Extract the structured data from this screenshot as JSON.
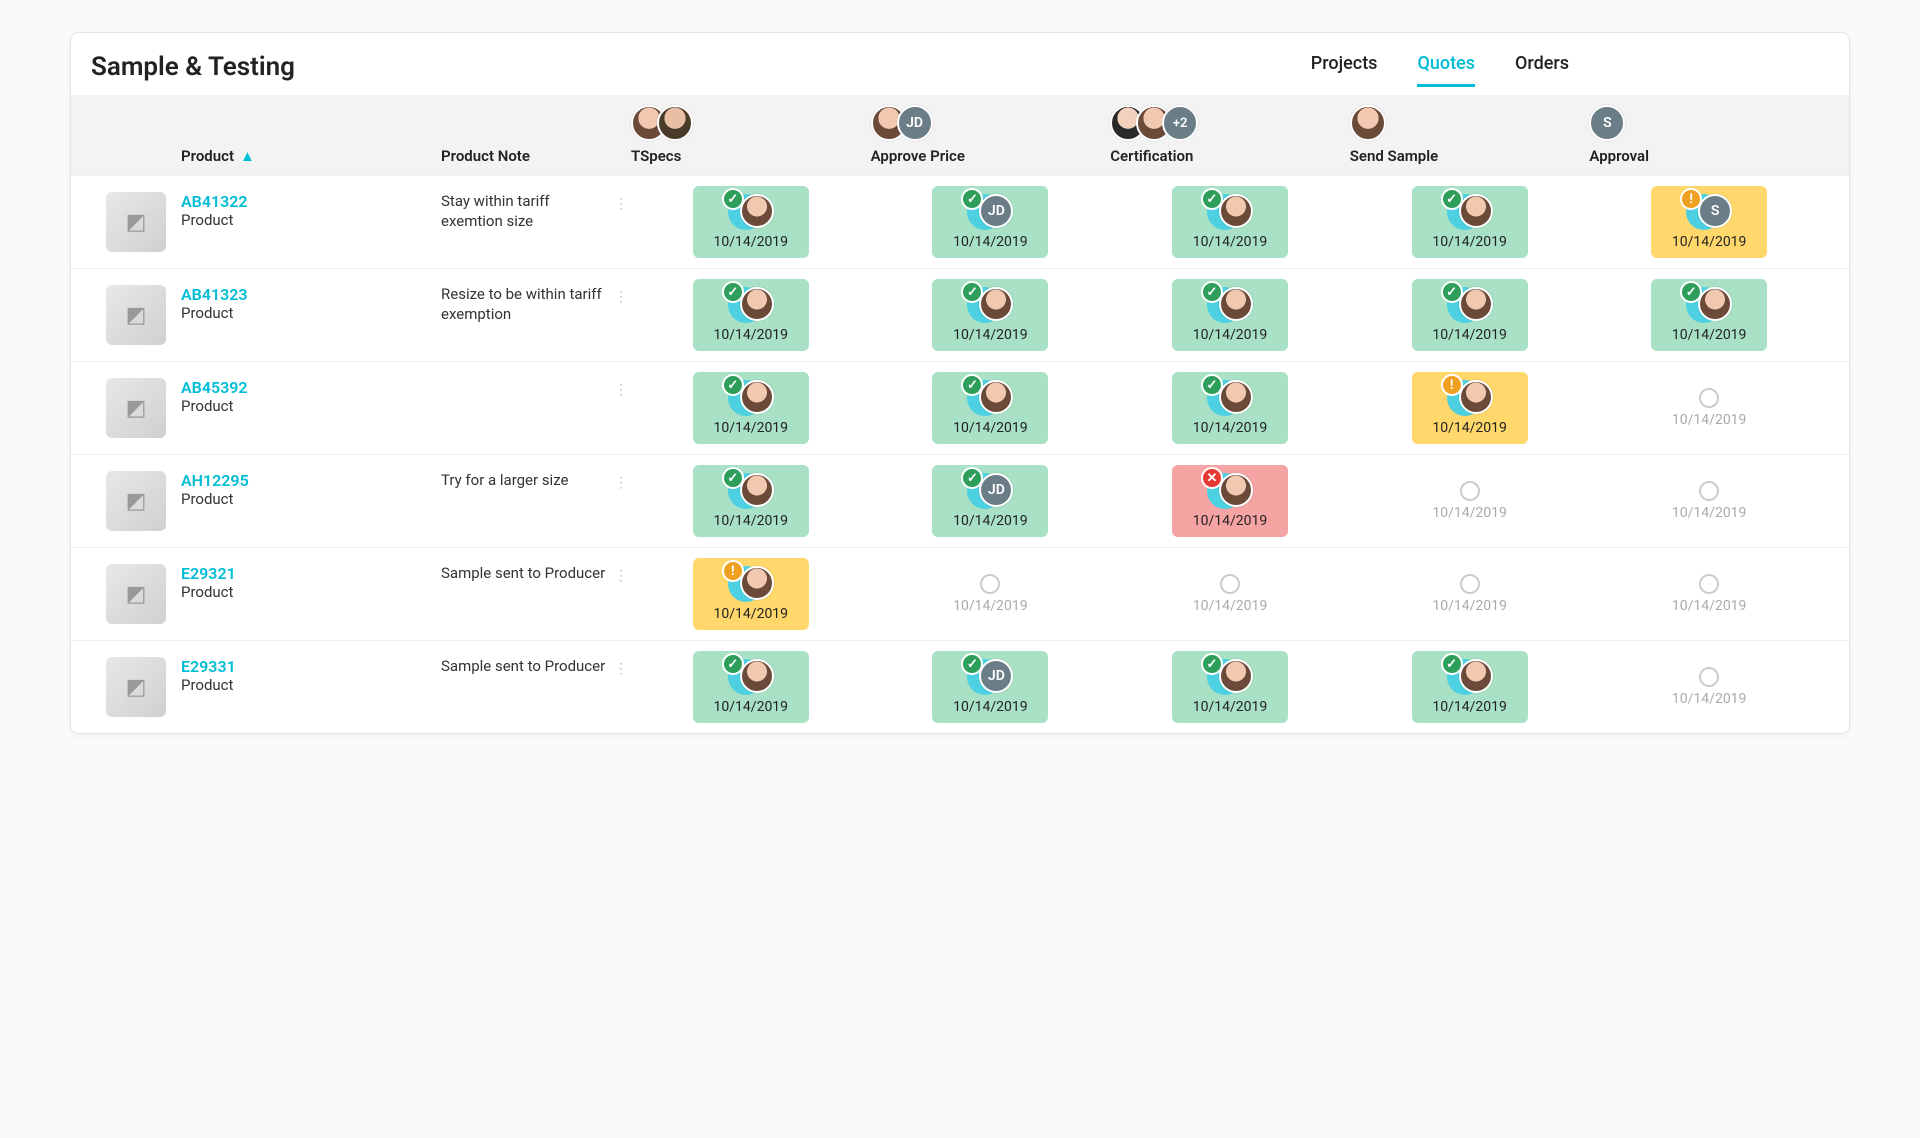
{
  "page_title": "Sample & Testing",
  "tabs": [
    {
      "label": "Projects",
      "active": false
    },
    {
      "label": "Quotes",
      "active": true
    },
    {
      "label": "Orders",
      "active": false
    }
  ],
  "columns": {
    "product": "Product",
    "note": "Product Note",
    "stages": [
      {
        "key": "tspecs",
        "label": "TSpecs",
        "avatars": [
          "face",
          "face2"
        ]
      },
      {
        "key": "approve_price",
        "label": "Approve Price",
        "avatars": [
          "face",
          "JD"
        ]
      },
      {
        "key": "certification",
        "label": "Certification",
        "avatars": [
          "face3",
          "face",
          "+2"
        ]
      },
      {
        "key": "send_sample",
        "label": "Send Sample",
        "avatars": [
          "face"
        ]
      },
      {
        "key": "approval",
        "label": "Approval",
        "avatars": [
          "S"
        ]
      }
    ]
  },
  "rows": [
    {
      "sku": "AB41322",
      "subtitle": "Product",
      "thumb_icon": "fan",
      "note": "Stay within tariff exemtion size",
      "stages": [
        {
          "status": "complete",
          "avatar": "face",
          "date": "10/14/2019"
        },
        {
          "status": "complete",
          "avatar": "JD",
          "date": "10/14/2019"
        },
        {
          "status": "complete",
          "avatar": "face",
          "date": "10/14/2019"
        },
        {
          "status": "complete",
          "avatar": "face",
          "date": "10/14/2019"
        },
        {
          "status": "warning",
          "avatar": "S",
          "date": "10/14/2019"
        }
      ]
    },
    {
      "sku": "AB41323",
      "subtitle": "Product",
      "thumb_icon": "ring-box",
      "note": "Resize to be within tariff exemption",
      "stages": [
        {
          "status": "complete",
          "avatar": "face",
          "date": "10/14/2019"
        },
        {
          "status": "complete",
          "avatar": "face",
          "date": "10/14/2019"
        },
        {
          "status": "complete",
          "avatar": "face",
          "date": "10/14/2019"
        },
        {
          "status": "complete",
          "avatar": "face",
          "date": "10/14/2019"
        },
        {
          "status": "complete",
          "avatar": "face",
          "date": "10/14/2019"
        }
      ]
    },
    {
      "sku": "AB45392",
      "subtitle": "Product",
      "thumb_icon": "earbuds",
      "note": "",
      "stages": [
        {
          "status": "complete",
          "avatar": "face",
          "date": "10/14/2019"
        },
        {
          "status": "complete",
          "avatar": "face",
          "date": "10/14/2019"
        },
        {
          "status": "complete",
          "avatar": "face",
          "date": "10/14/2019"
        },
        {
          "status": "warning",
          "avatar": "face",
          "date": "10/14/2019"
        },
        {
          "status": "empty",
          "date": "10/14/2019"
        }
      ]
    },
    {
      "sku": "AH12295",
      "subtitle": "Product",
      "thumb_icon": "necklace",
      "note": "Try for a larger size",
      "stages": [
        {
          "status": "complete",
          "avatar": "face",
          "date": "10/14/2019"
        },
        {
          "status": "complete",
          "avatar": "JD",
          "date": "10/14/2019"
        },
        {
          "status": "error",
          "avatar": "face",
          "date": "10/14/2019"
        },
        {
          "status": "empty",
          "date": "10/14/2019"
        },
        {
          "status": "empty",
          "date": "10/14/2019"
        }
      ]
    },
    {
      "sku": "E29321",
      "subtitle": "Product",
      "thumb_icon": "speaker",
      "note": "Sample sent to Producer",
      "stages": [
        {
          "status": "warning",
          "avatar": "face",
          "date": "10/14/2019"
        },
        {
          "status": "empty",
          "date": "10/14/2019"
        },
        {
          "status": "empty",
          "date": "10/14/2019"
        },
        {
          "status": "empty",
          "date": "10/14/2019"
        },
        {
          "status": "empty",
          "date": "10/14/2019"
        }
      ]
    },
    {
      "sku": "E29331",
      "subtitle": "Product",
      "thumb_icon": "coat",
      "note": "Sample sent to Producer",
      "stages": [
        {
          "status": "complete",
          "avatar": "face",
          "date": "10/14/2019"
        },
        {
          "status": "complete",
          "avatar": "JD",
          "date": "10/14/2019"
        },
        {
          "status": "complete",
          "avatar": "face",
          "date": "10/14/2019"
        },
        {
          "status": "complete",
          "avatar": "face",
          "date": "10/14/2019"
        },
        {
          "status": "empty",
          "date": "10/14/2019"
        }
      ]
    }
  ],
  "colors": {
    "accent": "#00bcd4",
    "complete_bg": "#a8e1c5",
    "warning_bg": "#ffd76a",
    "error_bg": "#f5a3a3",
    "check_badge": "#2e9e5b",
    "warn_badge": "#f0a020",
    "error_badge": "#e53935"
  }
}
